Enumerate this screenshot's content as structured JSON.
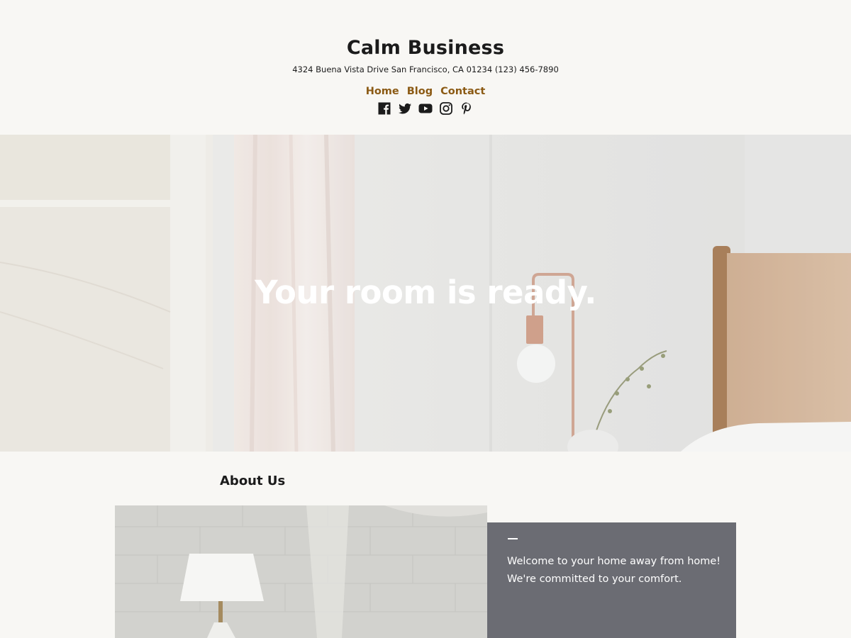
{
  "header": {
    "site_title": "Calm Business",
    "tagline": "4324 Buena Vista Drive San Francisco, CA 01234 (123) 456-7890",
    "nav": [
      {
        "label": "Home"
      },
      {
        "label": "Blog"
      },
      {
        "label": "Contact"
      }
    ],
    "social_icons": [
      "facebook-icon",
      "twitter-icon",
      "youtube-icon",
      "instagram-icon",
      "pinterest-icon"
    ]
  },
  "hero": {
    "title": "Your room is ready."
  },
  "about": {
    "heading": "About Us",
    "card_text": "Welcome to your home away from home! We're committed to your comfort."
  },
  "colors": {
    "background": "#f8f7f4",
    "nav_link": "#8b5a14",
    "card_background": "#6b6c73",
    "text": "#1b1b1b"
  }
}
